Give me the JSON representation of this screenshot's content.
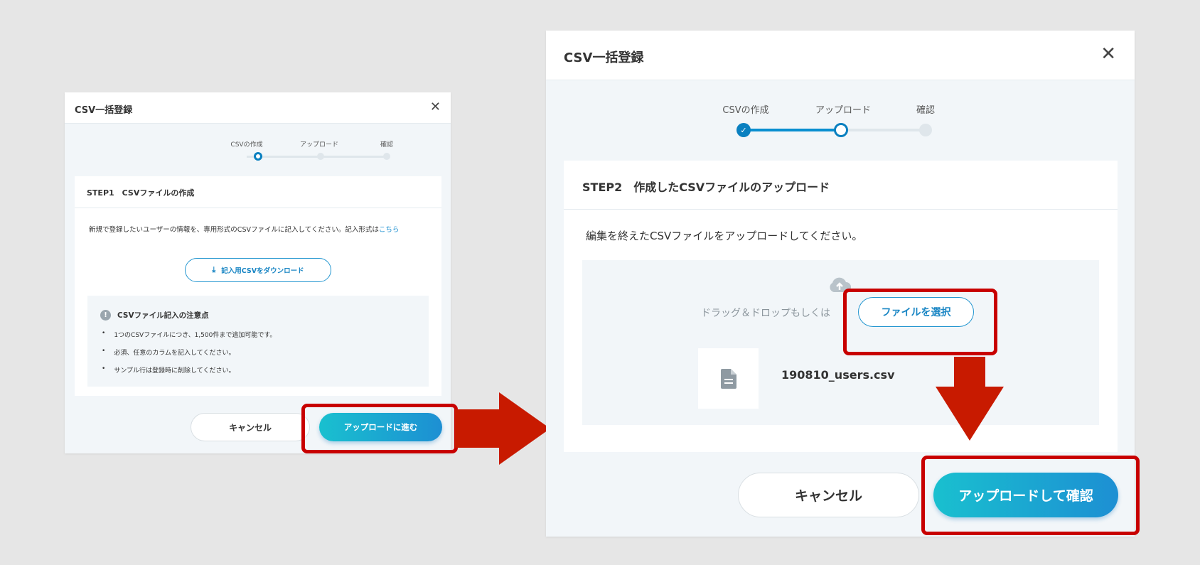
{
  "left": {
    "title": "CSV一括登録",
    "steps": [
      "CSVの作成",
      "アップロード",
      "確認"
    ],
    "card_title": "STEP1　CSVファイルの作成",
    "desc": "新規で登録したいユーザーの情報を、専用形式のCSVファイルに記入してください。記入形式は",
    "desc_link": "こちら",
    "download_label": "記入用CSVをダウンロード",
    "notice_title": "CSVファイル記入の注意点",
    "notice_items": [
      "1つのCSVファイルにつき、1,500件まで追加可能です。",
      "必須、任意のカラムを記入してください。",
      "サンプル行は登録時に削除してください。"
    ],
    "cancel_label": "キャンセル",
    "next_label": "アップロードに進む"
  },
  "right": {
    "title": "CSV一括登録",
    "steps": [
      "CSVの作成",
      "アップロード",
      "確認"
    ],
    "card_title": "STEP2　作成したCSVファイルのアップロード",
    "desc": "編集を終えたCSVファイルをアップロードしてください。",
    "drop_text": "ドラッグ＆ドロップもしくは",
    "select_label": "ファイルを選択",
    "file_name": "190810_users.csv",
    "cancel_label": "キャンセル",
    "upload_label": "アップロードして確認"
  },
  "colors": {
    "highlight": "#c80000",
    "arrow": "#c81a00",
    "accent": "#0a80c0"
  },
  "icons": {
    "close": "close-icon",
    "download": "download-icon",
    "info": "info-icon",
    "cloud_upload": "cloud-upload-icon",
    "file": "file-icon",
    "check": "check-icon"
  }
}
